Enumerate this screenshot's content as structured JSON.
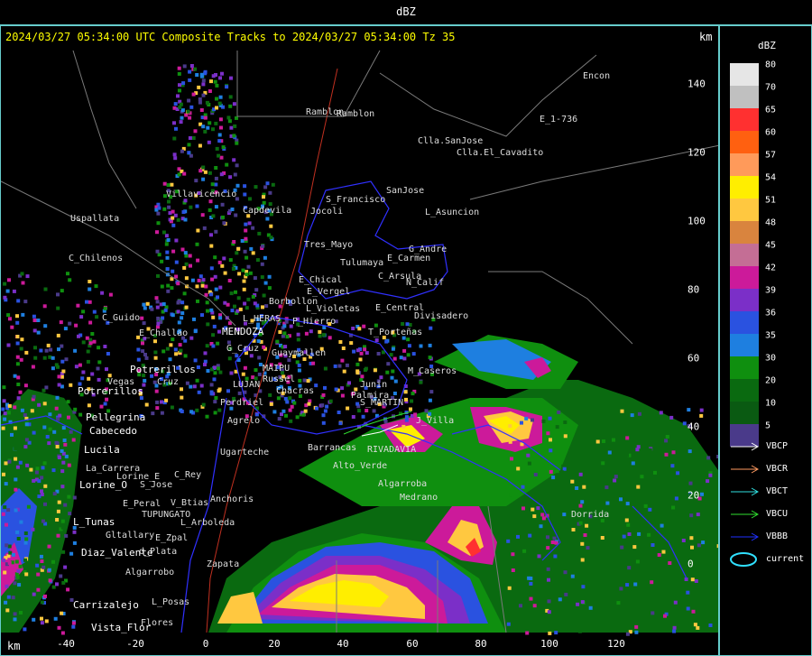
{
  "window": {
    "title": "dBZ"
  },
  "header": {
    "text": "2024/03/27 05:34:00 UTC Composite Tracks to 2024/03/27 05:34:00 Tz 35",
    "km_top": "km",
    "km_bottom": "km"
  },
  "axes": {
    "x_ticks": [
      "-40",
      "-20",
      "0",
      "20",
      "40",
      "60",
      "80",
      "100",
      "120"
    ],
    "y_ticks": [
      "140",
      "120",
      "100",
      "80",
      "60",
      "40",
      "20",
      "0"
    ]
  },
  "legend": {
    "unit": "dBZ",
    "scale": [
      {
        "value": "80",
        "color": "#e6e6e6"
      },
      {
        "value": "70",
        "color": "#c0c0c0"
      },
      {
        "value": "65",
        "color": "#ff3030"
      },
      {
        "value": "60",
        "color": "#ff6010"
      },
      {
        "value": "57",
        "color": "#ff9a5a"
      },
      {
        "value": "54",
        "color": "#ffee00"
      },
      {
        "value": "51",
        "color": "#ffc840"
      },
      {
        "value": "48",
        "color": "#d9843e"
      },
      {
        "value": "45",
        "color": "#c46e95"
      },
      {
        "value": "42",
        "color": "#cc1a9a"
      },
      {
        "value": "39",
        "color": "#7b2fc8"
      },
      {
        "value": "36",
        "color": "#2a52e0"
      },
      {
        "value": "35",
        "color": "#1e7fe0"
      },
      {
        "value": "30",
        "color": "#0f8f0f"
      },
      {
        "value": "20",
        "color": "#0a6a10"
      },
      {
        "value": "10",
        "color": "#0a5a12"
      },
      {
        "value": "5",
        "color": "#4a3a8a"
      }
    ],
    "tracks": [
      {
        "label": "VBCP",
        "color": "#ffffff"
      },
      {
        "label": "VBCR",
        "color": "#ff9a60"
      },
      {
        "label": "VBCT",
        "color": "#30e0e0"
      },
      {
        "label": "VBCU",
        "color": "#30e030"
      },
      {
        "label": "VBBB",
        "color": "#2030ff"
      },
      {
        "label": "current",
        "color": "#30e0ff"
      }
    ]
  },
  "places": [
    {
      "name": "Ramblon"
    },
    {
      "name": "Encon"
    },
    {
      "name": "E_1-736"
    },
    {
      "name": "Clla.SanJose"
    },
    {
      "name": "Clla.El_Cavadito"
    },
    {
      "name": "SanJose"
    },
    {
      "name": "S_Francisco"
    },
    {
      "name": "Jocoli"
    },
    {
      "name": "L_Asuncion"
    },
    {
      "name": "Villavicencio"
    },
    {
      "name": "Capdevila"
    },
    {
      "name": "Uspallata"
    },
    {
      "name": "Tres_Mayo"
    },
    {
      "name": "G_Andre"
    },
    {
      "name": "Tulumaya"
    },
    {
      "name": "E_Carmen"
    },
    {
      "name": "C_Chilenos"
    },
    {
      "name": "E_Chical"
    },
    {
      "name": "C_Arsula"
    },
    {
      "name": "E_Vergel"
    },
    {
      "name": "N_Calif"
    },
    {
      "name": "Borbollon"
    },
    {
      "name": "L_Violetas"
    },
    {
      "name": "E_Central"
    },
    {
      "name": "Divisadero"
    },
    {
      "name": "C_Guido"
    },
    {
      "name": "MENDOZA"
    },
    {
      "name": "L_HERAS"
    },
    {
      "name": "P_Hierro"
    },
    {
      "name": "T_Porteñas"
    },
    {
      "name": "E_Challao"
    },
    {
      "name": "G_Cruz"
    },
    {
      "name": "Guaymallen"
    },
    {
      "name": "Potrerillos"
    },
    {
      "name": "MAIPU"
    },
    {
      "name": "Russel"
    },
    {
      "name": "M_Caseros"
    },
    {
      "name": "Chacras"
    },
    {
      "name": "Vegas"
    },
    {
      "name": "Cruz"
    },
    {
      "name": "LUJAN"
    },
    {
      "name": "Potrerillos"
    },
    {
      "name": "Pellegrina"
    },
    {
      "name": "Cabecedo"
    },
    {
      "name": "Perdriel"
    },
    {
      "name": "Agrelo"
    },
    {
      "name": "Lucila"
    },
    {
      "name": "Ugarteche"
    },
    {
      "name": "La_Carrera"
    },
    {
      "name": "Lorine_E"
    },
    {
      "name": "C_Rey"
    },
    {
      "name": "Lorine_O"
    },
    {
      "name": "S_Jose"
    },
    {
      "name": "Anchoris"
    },
    {
      "name": "E_Peral"
    },
    {
      "name": "V_Btias"
    },
    {
      "name": "TUPUNGATO"
    },
    {
      "name": "L_Arboleda"
    },
    {
      "name": "L_Tunas"
    },
    {
      "name": "Gltallary"
    },
    {
      "name": "E_Zpal"
    },
    {
      "name": "Diaz_Valente"
    },
    {
      "name": "d_Plata"
    },
    {
      "name": "Zapata"
    },
    {
      "name": "Algarrobo"
    },
    {
      "name": "Carrizalejo"
    },
    {
      "name": "Vista_Flor"
    },
    {
      "name": "L_Posas"
    },
    {
      "name": "Flores"
    },
    {
      "name": "Dorrida"
    },
    {
      "name": "S_MARTIN"
    },
    {
      "name": "RIVADAVIA"
    },
    {
      "name": "Medrano"
    },
    {
      "name": "Algarroba"
    },
    {
      "name": "Junin"
    },
    {
      "name": "Palmira"
    },
    {
      "name": "Barrancas"
    },
    {
      "name": "Alto_Verde"
    },
    {
      "name": "Ramblon"
    },
    {
      "name": "J_Villa"
    }
  ],
  "map_colors": {
    "background": "#000000",
    "province": "#3030ff",
    "road": "#c03020",
    "boundary": "#7a7a7a",
    "frame": "#66cccc"
  }
}
